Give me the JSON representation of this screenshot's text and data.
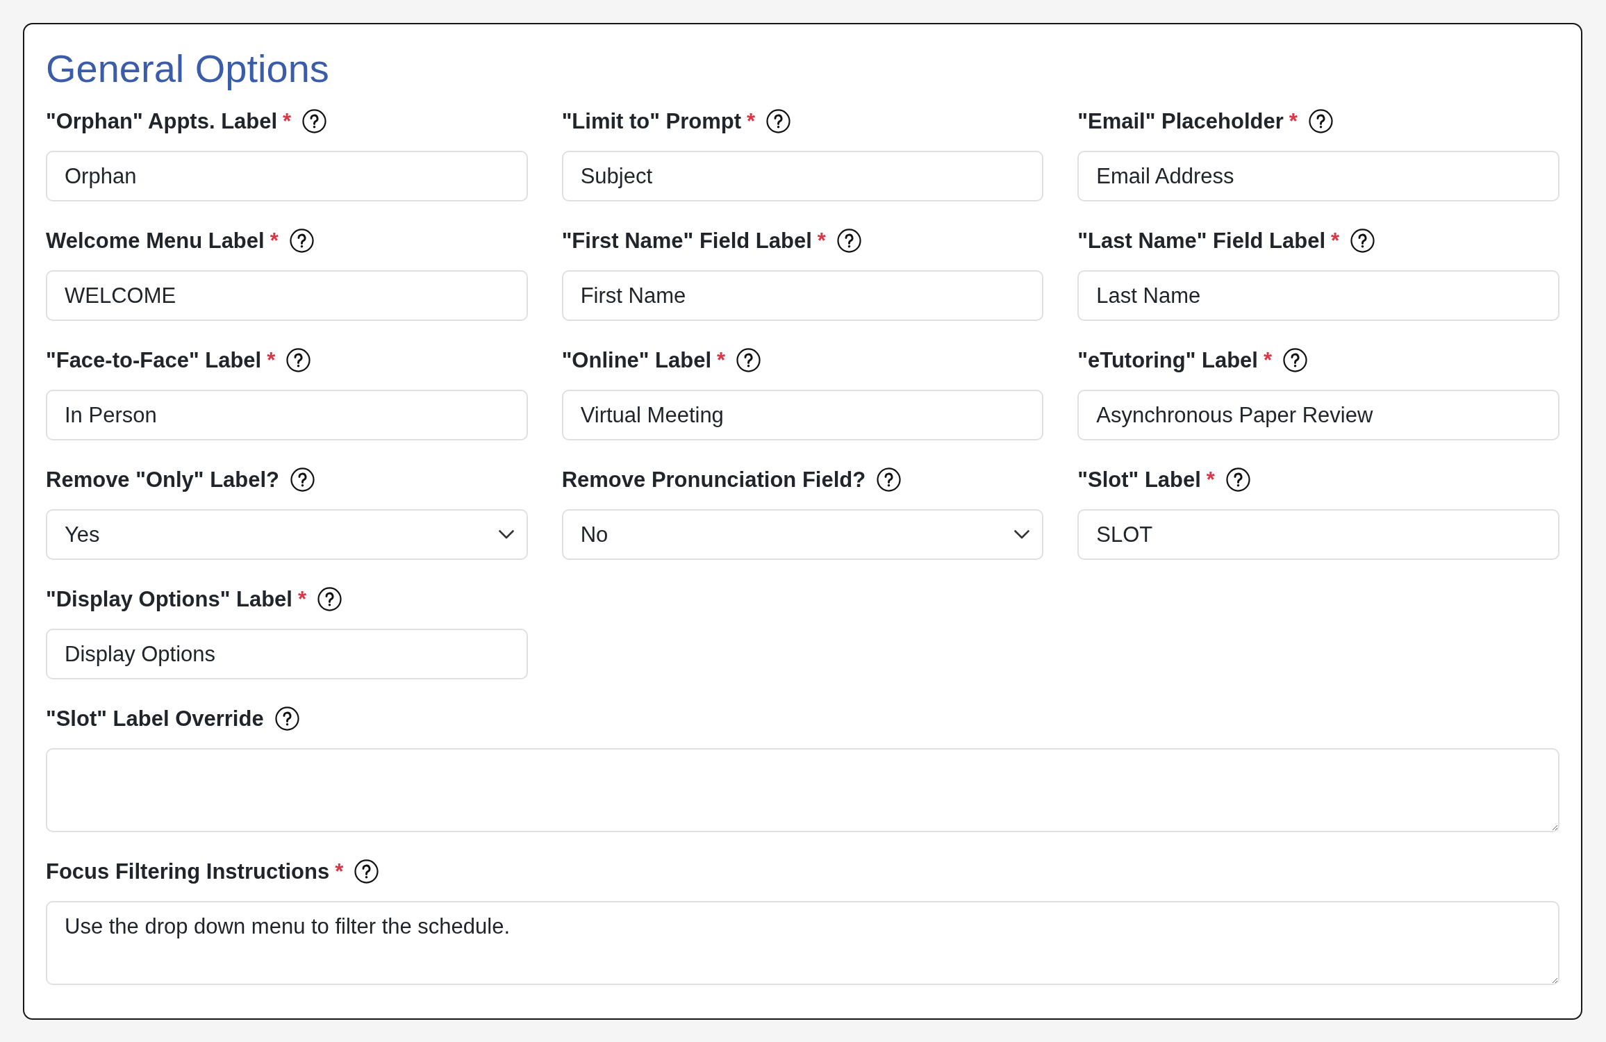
{
  "section": {
    "title": "General Options"
  },
  "fields": [
    {
      "kind": "text",
      "label": "\"Orphan\" Appts. Label",
      "required_mark": "*",
      "value": "Orphan"
    },
    {
      "kind": "text",
      "label": "\"Limit to\" Prompt",
      "required_mark": "*",
      "value": "Subject"
    },
    {
      "kind": "text",
      "label": "\"Email\" Placeholder",
      "required_mark": "*",
      "value": "Email Address"
    },
    {
      "kind": "text",
      "label": "Welcome Menu Label",
      "required_mark": "*",
      "value": "WELCOME"
    },
    {
      "kind": "text",
      "label": "\"First Name\" Field Label",
      "required_mark": "*",
      "value": "First Name"
    },
    {
      "kind": "text",
      "label": "\"Last Name\" Field Label",
      "required_mark": "*",
      "value": "Last Name"
    },
    {
      "kind": "text",
      "label": "\"Face-to-Face\" Label",
      "required_mark": "*",
      "value": "In Person"
    },
    {
      "kind": "text",
      "label": "\"Online\" Label",
      "required_mark": "*",
      "value": "Virtual Meeting"
    },
    {
      "kind": "text",
      "label": "\"eTutoring\" Label",
      "required_mark": "*",
      "value": "Asynchronous Paper Review"
    },
    {
      "kind": "select",
      "label": "Remove \"Only\" Label?",
      "value": "Yes"
    },
    {
      "kind": "select",
      "label": "Remove Pronunciation Field?",
      "value": "No"
    },
    {
      "kind": "text",
      "label": "\"Slot\" Label",
      "required_mark": "*",
      "value": "SLOT"
    },
    {
      "kind": "text",
      "label": "\"Display Options\" Label",
      "required_mark": "*",
      "value": "Display Options"
    },
    {
      "kind": "textarea",
      "label": "\"Slot\" Label Override"
    },
    {
      "kind": "textarea",
      "label": "Focus Filtering Instructions",
      "required_mark": "*",
      "value": "Use the drop down menu to filter the schedule."
    }
  ]
}
